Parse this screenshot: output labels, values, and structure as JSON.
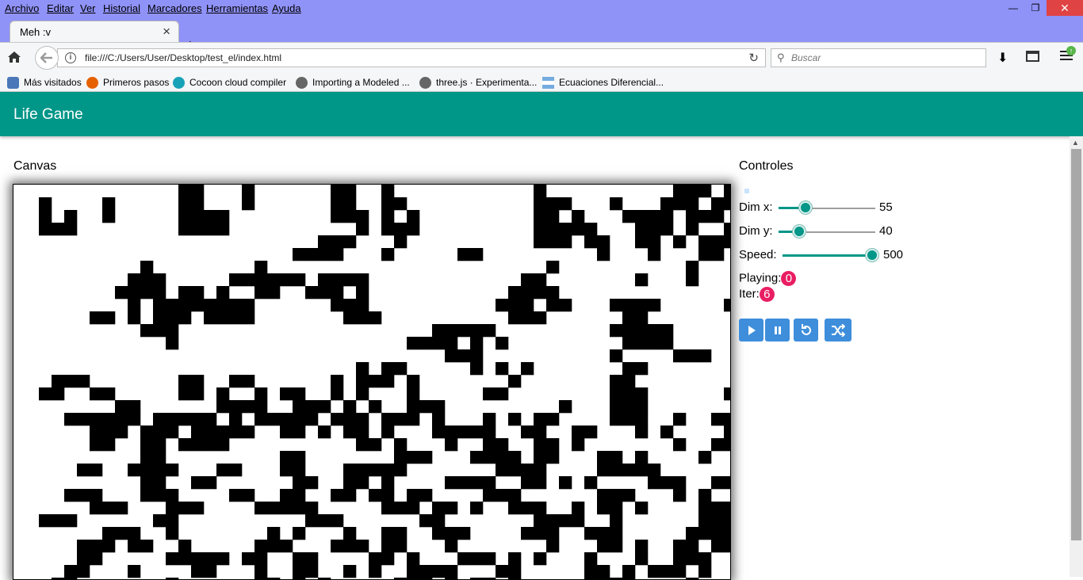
{
  "menu": [
    "Archivo",
    "Editar",
    "Ver",
    "Historial",
    "Marcadores",
    "Herramientas",
    "Ayuda"
  ],
  "tab": {
    "title": "Meh :v"
  },
  "address": {
    "url": "file:///C:/Users/User/Desktop/test_el/index.html"
  },
  "search": {
    "placeholder": "Buscar"
  },
  "bookmarks": [
    {
      "label": "Más visitados",
      "icon": "most-visited-icon",
      "color": "#4a78b8"
    },
    {
      "label": "Primeros pasos",
      "icon": "firefox-icon",
      "color": "#e66000"
    },
    {
      "label": "Cocoon cloud compiler",
      "icon": "cocoon-icon",
      "color": "#17a2b8"
    },
    {
      "label": "Importing a Modeled ...",
      "icon": "globe-icon",
      "color": "#666666"
    },
    {
      "label": "three.js · Experimenta...",
      "icon": "globe-icon",
      "color": "#666666"
    },
    {
      "label": "Ecuaciones Diferencial...",
      "icon": "flag-icon",
      "color": "#74acdf"
    }
  ],
  "app": {
    "title": "Life Game",
    "canvas_title": "Canvas",
    "controls_title": "Controles",
    "controls": {
      "dim_x": {
        "label": "Dim x:",
        "value": "55",
        "fraction": 0.29
      },
      "dim_y": {
        "label": "Dim y:",
        "value": "40",
        "fraction": 0.22
      },
      "speed": {
        "label": "Speed:",
        "value": "500",
        "fraction": 1.0
      }
    },
    "playing": {
      "label": "Playing:",
      "value": "0"
    },
    "iter": {
      "label": "Iter:",
      "value": "6"
    },
    "buttons": [
      "play-icon",
      "pause-icon",
      "reset-icon",
      "shuffle-icon"
    ]
  },
  "colors": {
    "accent": "#009688",
    "badge": "#e91e63",
    "button": "#3e8edb",
    "chrome": "#8f92f7"
  },
  "board": {
    "cell_rows": [
      ".............xx...x......xx..x...........x..........xxx.xxx.xxx..xx...",
      "..x....x.....xx...x......xx..xx..........xxx...x...xxx.xxx.xx.xxx.xxx.",
      "..x.x..x.....xxxx........xxx.x.x.........xx.x...xxxx.xxx.xxx.xxx..xx..",
      "..xxx........xxxx..........x.xxx.........xxxxx...xxx.x..xxx..xxxx...x.",
      "........................xxx...x..........xxx.xx..xx.x.xxx....xxx......",
      "......................xxxx...x.....xx.........x...x...xx...xx..xxx....",
      "..........x........x......................x..........x....x...xxx.....",
      ".........xxx.....xxxxxx.xxxx............xx.......x...x...x...xx.......",
      "........xxxx.xx.x..xx..xxx.x...........xxxx...............x...........",
      ".........x.xxxxxxxx......xxx..........xxx.xx...xxxx.....xxx.....xxx...",
      "......xx.x.xxx.xxxx.......xxx..........xxx......xx..........xxx..xx..",
      "..........xxx....................xxxxx.........xxxxx.....x...xx.....xx",
      "............x..................xxxx.x.x.........xxxx..........xx......",
      "..................................xxx..........x....xxx....xx.........",
      "...........................x.xx.....x.x.x.......xx...........x.x......",
      "...xxx.......xx..xx......x.xxx.x.......x.......xx...........xxxx......",
      "..xx..xx.....xx.x..x.xx..x.x...x.....xx........xxx......xxx.xxx.......",
      "........xx......xxxx..xxx.x.x..xxx.........x...xxx.........x..........",
      "....xxxxxx.xxxxx.x.xxxxx.xxx.xxx.x...x.x.xx....xxx..x..xx.xxxx....xxxx",
      "......xxx.xxx.xxxxx..xx.x.xx.x...xxxxx..xx..xx...x.x....x....xxx...x..",
      "......xx..xx.xxxx..........xx.x...x..xx..xx.x.......x..xxx...........",
      "..........xx.........xx.......xxx...xxxx.xx...xx.x....x..x...xx.......",
      ".....xx..xxxx...xx...xx...xxxxx.......xxxx....xxxxx.......xxxxxx.xx...",
      "..........xx..xx......xx..xx.x....xxxx..xx.x.x....xxx..xx...xxx.xx....",
      "....xxx...xxx....xx..xx..xx.xx.xx....xxx......xxx...x.x..xxxxx...xx...",
      "......xxx...xxx....xxxxx.....xxx.xx.x..xxx..x.xx.x....xxx..xx.xx......",
      "..xxx......xx..........xxx......xx.......xxxx..x......xxxxx.x...xx.x..",
      ".......xxx..x.......x.x...x..xx..xxx....xxx..xxx.....xxxxx..x..xx.....",
      ".....xxx.xx..x.....xxx...xxx.xx...x.......x...xx.x..xx.xx..xxx.....xx.",
      ".....xx.....xxxxx.xx..xx....xx.x...xxx.x.x...x...x..xxx...x.xxx.....x.",
      "....xx...x....xx...x..xx..x.x..xxxx...xx.....xx.x.xxx.x.....x...xxx...",
      "...xx.......x......xx.x.x.....xxx.x.xx.x.....xxxx....x.....xx....xx.x."
    ],
    "grid": {
      "rows": 31,
      "cols": 70
    }
  }
}
